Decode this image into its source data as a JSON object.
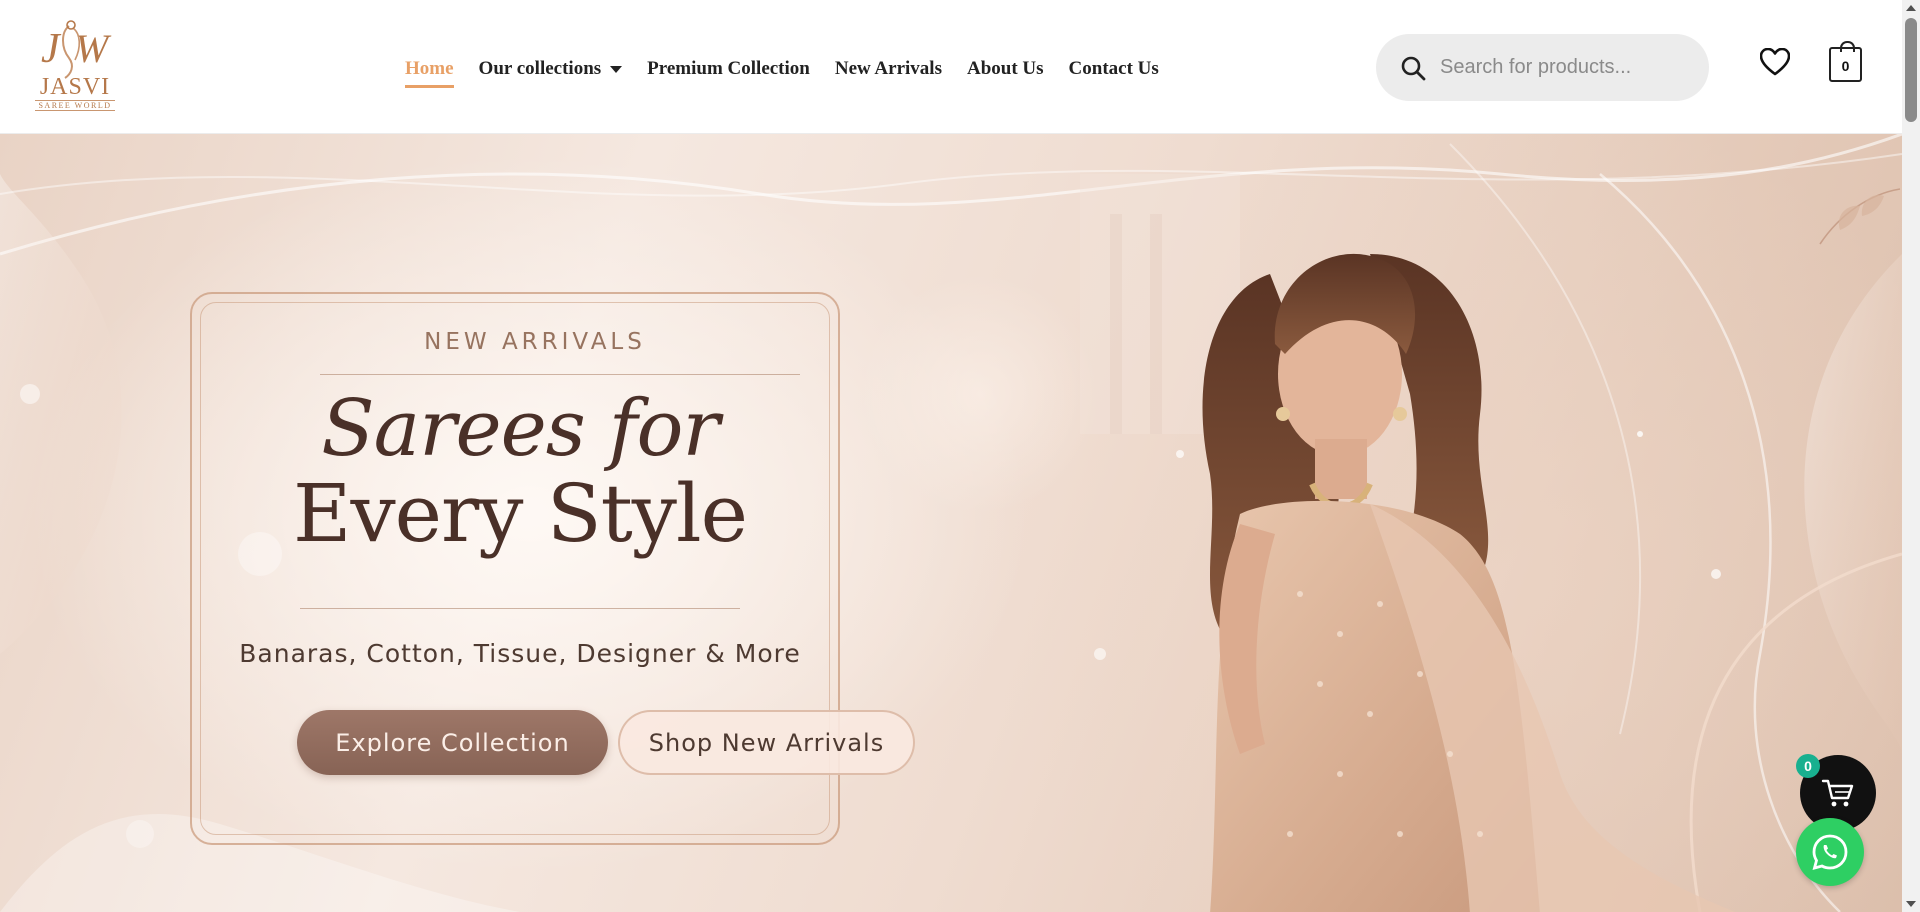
{
  "brand": {
    "monogram": "JW",
    "name": "JASVI",
    "tagline": "SAREE WORLD"
  },
  "nav": {
    "items": [
      {
        "label": "Home",
        "active": true
      },
      {
        "label": "Our collections",
        "has_dropdown": true
      },
      {
        "label": "Premium Collection"
      },
      {
        "label": "New Arrivals"
      },
      {
        "label": "About Us"
      },
      {
        "label": "Contact Us"
      }
    ]
  },
  "search": {
    "placeholder": "Search for products...",
    "value": "",
    "icon": "search-icon"
  },
  "header_icons": {
    "wishlist_icon": "heart-icon",
    "cart_icon": "shopping-bag-icon",
    "cart_count": "0"
  },
  "hero": {
    "eyebrow": "NEW ARRIVALS",
    "headline_line1": "Sarees for",
    "headline_line2": "Every Style",
    "subheading": "Banaras, Cotton, Tissue, Designer & More",
    "primary_button": "Explore Collection",
    "secondary_button": "Shop New Arrivals"
  },
  "floating": {
    "cart_badge": "0",
    "cart_icon": "cart-icon",
    "chat_icon": "whatsapp-icon"
  },
  "colors": {
    "accent": "#e8a066",
    "brand": "#b5784a",
    "primary_button": "#8f6b5d",
    "whatsapp": "#2ecf63",
    "badge": "#18b08f"
  }
}
